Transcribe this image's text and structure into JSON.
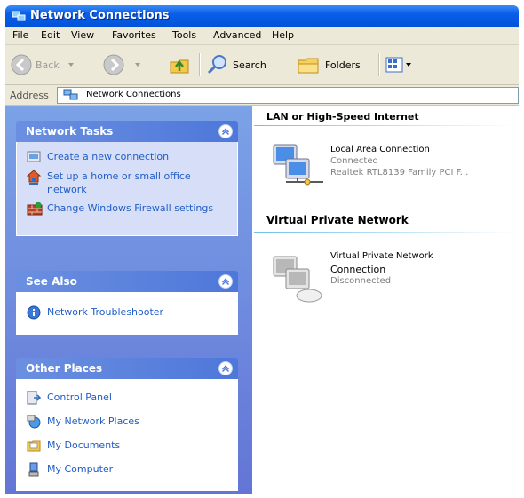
{
  "window": {
    "title": "Network Connections"
  },
  "menu": {
    "items": [
      "File",
      "Edit",
      "View",
      "Favorites",
      "Tools",
      "Advanced",
      "Help"
    ]
  },
  "toolbar": {
    "back_label": "Back",
    "search_label": "Search",
    "folders_label": "Folders"
  },
  "address": {
    "label": "Address",
    "value": "Network Connections"
  },
  "sidebar": {
    "network_tasks": {
      "title": "Network Tasks",
      "items": [
        {
          "label": "Create a new connection",
          "icon": "new-connection-icon"
        },
        {
          "label": "Set up a home or small office network",
          "icon": "home-network-icon"
        },
        {
          "label": "Change Windows Firewall settings",
          "icon": "firewall-icon"
        }
      ]
    },
    "see_also": {
      "title": "See Also",
      "items": [
        {
          "label": "Network Troubleshooter",
          "icon": "info-icon"
        }
      ]
    },
    "other_places": {
      "title": "Other Places",
      "items": [
        {
          "label": "Control Panel",
          "icon": "control-panel-icon"
        },
        {
          "label": "My Network Places",
          "icon": "network-places-icon"
        },
        {
          "label": "My Documents",
          "icon": "documents-folder-icon"
        },
        {
          "label": "My Computer",
          "icon": "computer-icon"
        }
      ]
    }
  },
  "content": {
    "lan_group": {
      "title": "LAN or High-Speed Internet",
      "item": {
        "name": "Local Area Connection",
        "status": "Connected",
        "device": "Realtek RTL8139 Family PCI F..."
      }
    },
    "vpn_group": {
      "title": "Virtual Private Network",
      "item": {
        "name_line1": "Virtual Private Network",
        "name_line2": "Connection",
        "status": "Disconnected"
      }
    }
  },
  "colors": {
    "titlebar": "#0a5ee8",
    "sidepane": "#7ba2e7",
    "task_link": "#215dc6",
    "chrome": "#ece9d8"
  }
}
